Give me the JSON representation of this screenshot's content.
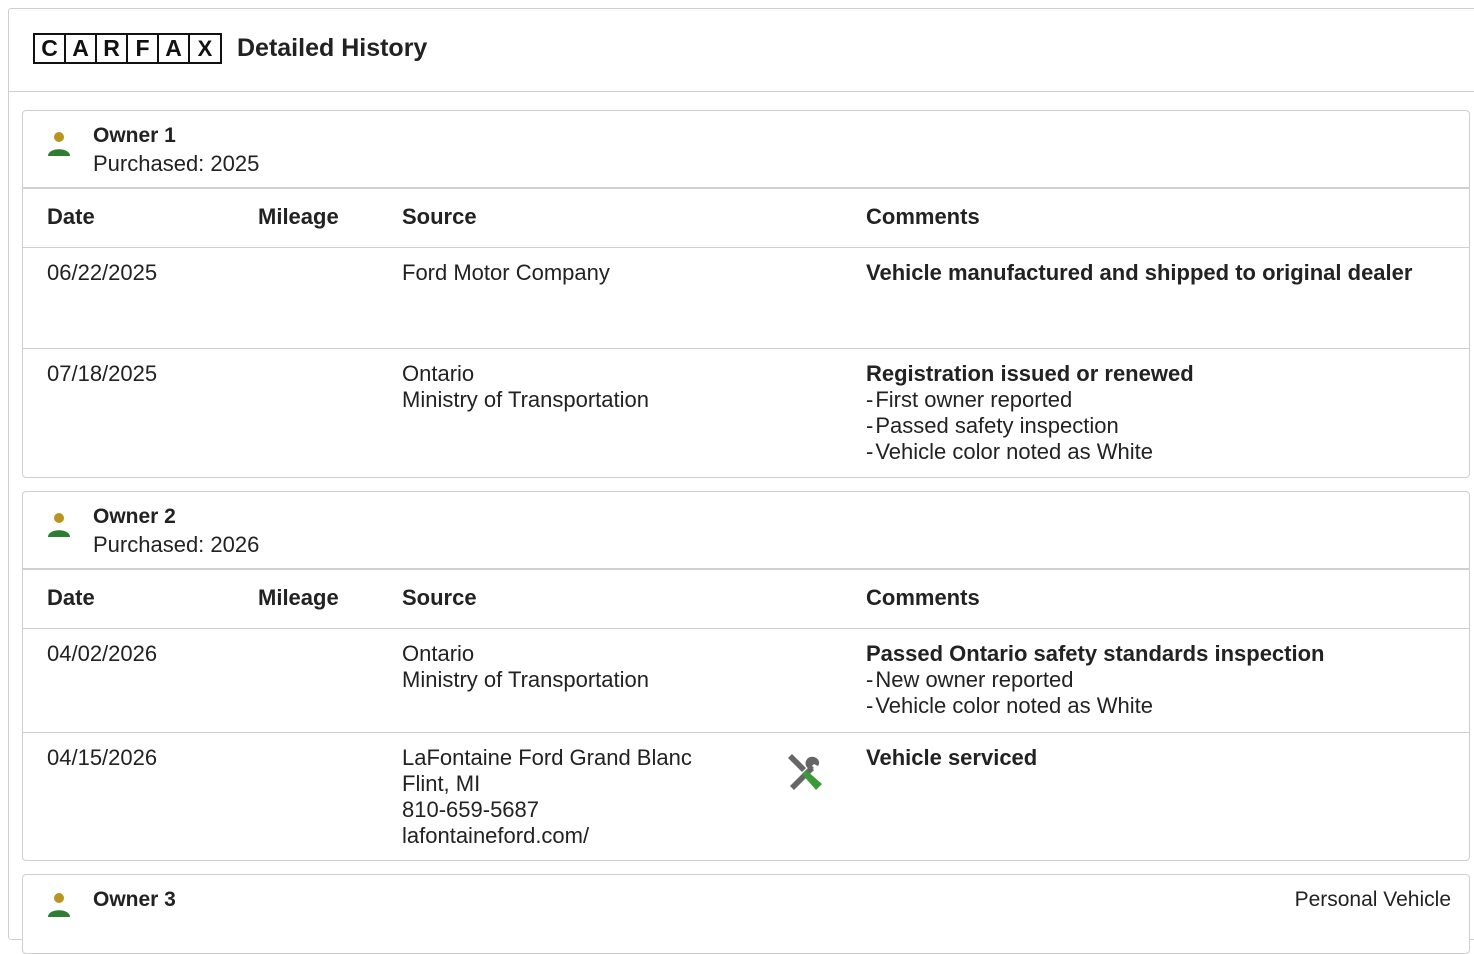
{
  "brand": {
    "logo_letters": [
      "C",
      "A",
      "R",
      "F",
      "A",
      "X"
    ],
    "title": "Detailed History"
  },
  "colors": {
    "owner_head": "#b8951f",
    "owner_body": "#2e7d32",
    "tool_green": "#3a9a3a",
    "tool_gray": "#666666"
  },
  "table_headers": {
    "date": "Date",
    "mileage": "Mileage",
    "source": "Source",
    "comments": "Comments"
  },
  "owners": [
    {
      "name": "Owner 1",
      "purchased": "Purchased: 2025",
      "icon": "person-icon",
      "records": [
        {
          "date": "06/22/2025",
          "mileage": "",
          "source": [
            "Ford Motor Company"
          ],
          "comment_title": "Vehicle manufactured and shipped to original dealer",
          "comment_items": []
        },
        {
          "date": "07/18/2025",
          "mileage": "",
          "source": [
            "Ontario",
            "Ministry of Transportation"
          ],
          "comment_title": "Registration issued or renewed",
          "comment_items": [
            "First owner reported",
            "Passed safety inspection",
            "Vehicle color noted as White"
          ]
        }
      ]
    },
    {
      "name": "Owner 2",
      "purchased": "Purchased: 2026",
      "icon": "person-icon",
      "records": [
        {
          "date": "04/02/2026",
          "mileage": "",
          "source": [
            "Ontario",
            "Ministry of Transportation"
          ],
          "comment_title": "Passed Ontario safety standards inspection",
          "comment_items": [
            "New owner reported",
            "Vehicle color noted as White"
          ]
        },
        {
          "date": "04/15/2026",
          "mileage": "",
          "source": [
            "LaFontaine Ford Grand Blanc",
            "Flint, MI",
            "810-659-5687",
            "lafontaineford.com/"
          ],
          "source_icon": "service-tools-icon",
          "comment_title": "Vehicle serviced",
          "comment_items": []
        }
      ]
    },
    {
      "name": "Owner 3",
      "type": "Personal Vehicle",
      "icon": "person-icon"
    }
  ]
}
